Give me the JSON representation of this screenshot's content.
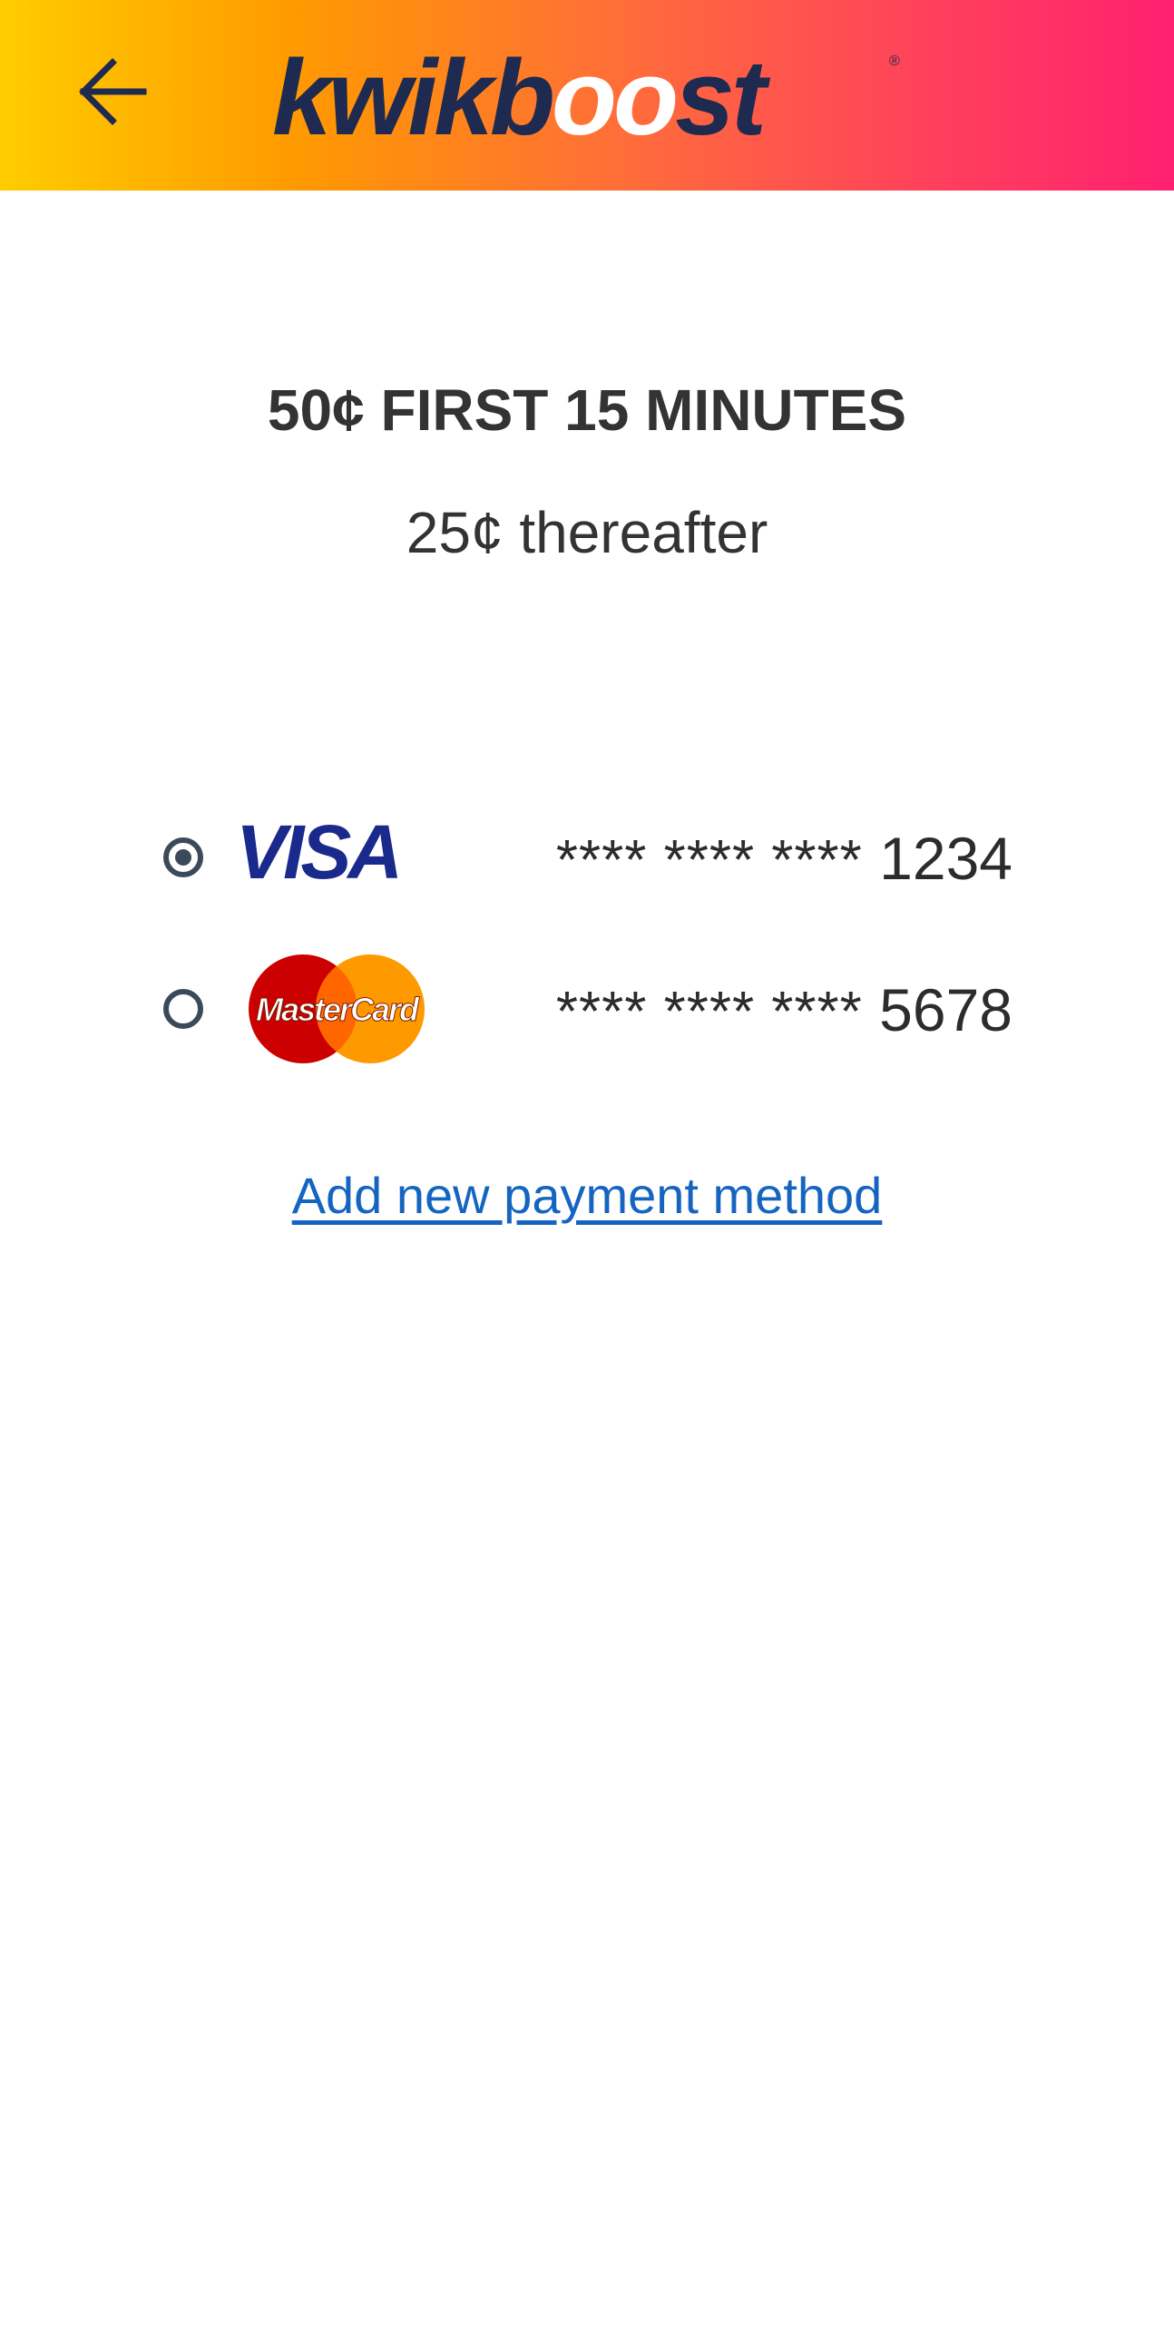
{
  "header": {
    "back_icon": "arrow-left-icon",
    "logo_text": "kwikboost",
    "colors": {
      "gradient_start": "#ffcc00",
      "gradient_end": "#ff2070",
      "logo_dark": "#1e2a4f"
    }
  },
  "pricing": {
    "primary": "50¢ FIRST 15 MINUTES",
    "secondary": "25¢ thereafter"
  },
  "payment_methods": [
    {
      "brand": "VISA",
      "masked": "**** **** ****",
      "last4": "1234",
      "selected": true
    },
    {
      "brand": "MasterCard",
      "masked": "**** **** ****",
      "last4": "5678",
      "selected": false
    }
  ],
  "add_payment_label": "Add new payment method"
}
